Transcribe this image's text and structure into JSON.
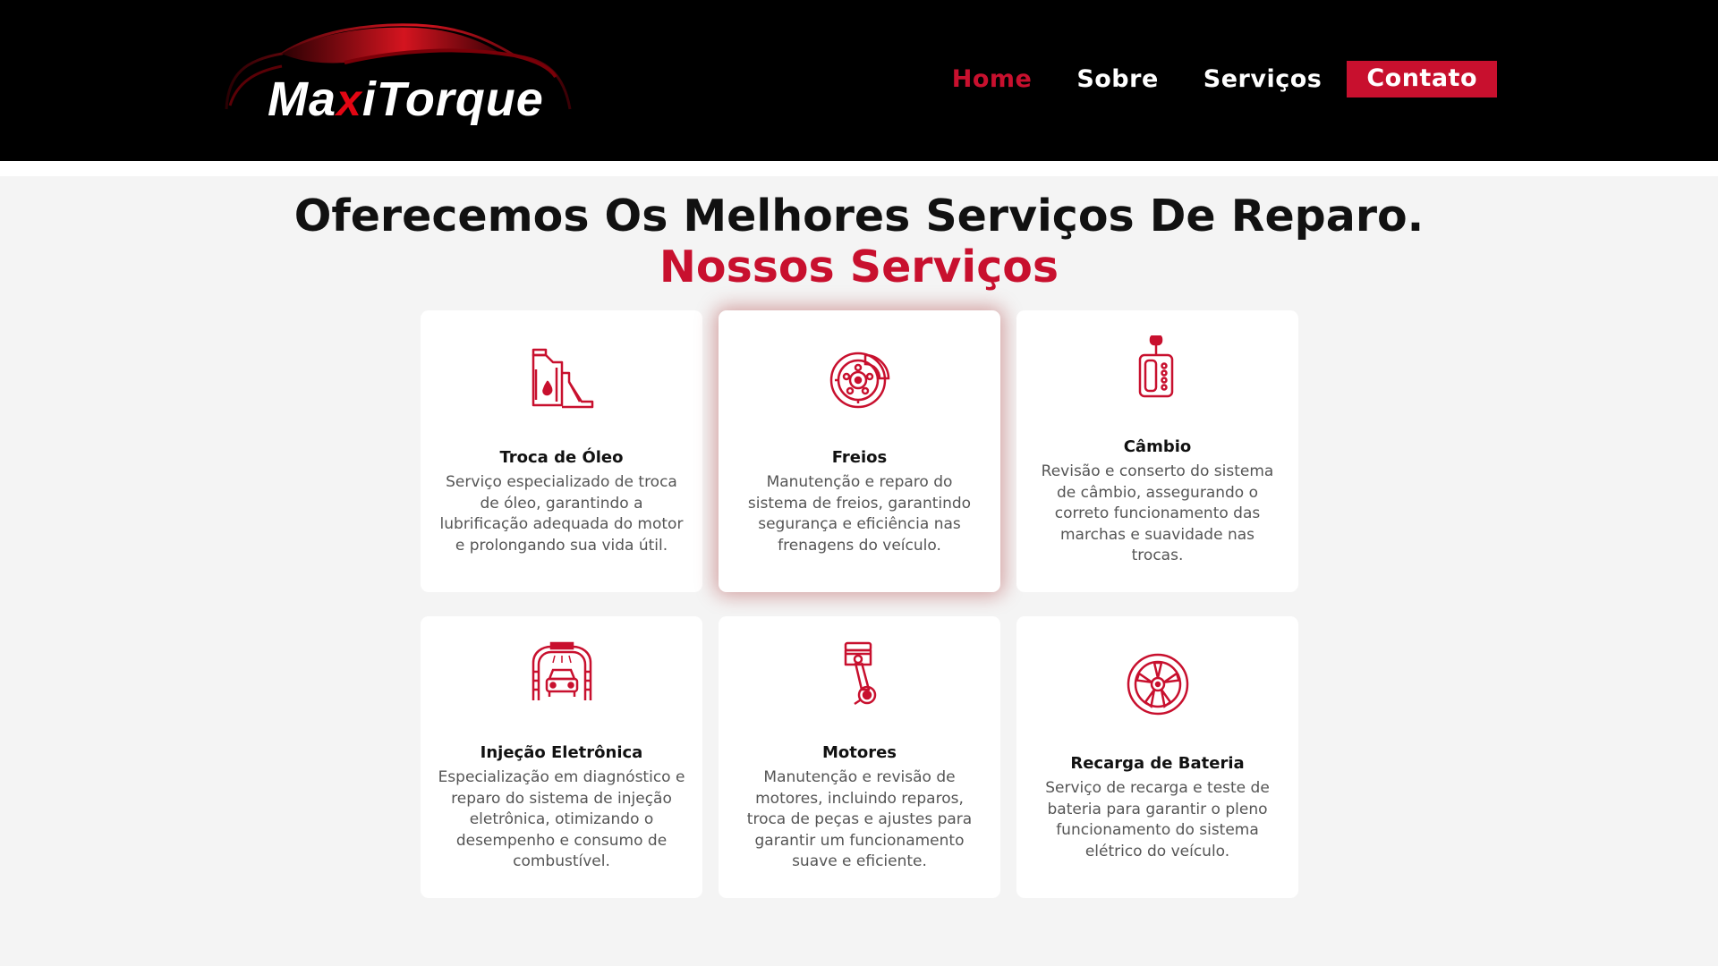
{
  "brand": {
    "name_part1": "Ma",
    "name_x": "x",
    "name_part2": "iTorque",
    "accent_color": "#c8102e"
  },
  "nav": {
    "items": [
      {
        "label": "Home",
        "active": true
      },
      {
        "label": "Sobre",
        "active": false
      },
      {
        "label": "Serviços",
        "active": false
      },
      {
        "label": "Contato",
        "active": false
      }
    ]
  },
  "hero": {
    "headline": "Oferecemos Os Melhores Serviços De Reparo.",
    "subheadline": "Nossos Serviços"
  },
  "services": [
    {
      "icon": "oil-can-icon",
      "title": "Troca de Óleo",
      "description": "Serviço especializado de troca de óleo, garantindo a lubrificação adequada do motor e prolongando sua vida útil."
    },
    {
      "icon": "brake-disc-icon",
      "title": "Freios",
      "description": "Manutenção e reparo do sistema de freios, garantindo segurança e eficiência nas frenagens do veículo."
    },
    {
      "icon": "gear-shifter-icon",
      "title": "Câmbio",
      "description": "Revisão e conserto do sistema de câmbio, assegurando o correto funcionamento das marchas e suavidade nas trocas."
    },
    {
      "icon": "car-wash-icon",
      "title": "Injeção Eletrônica",
      "description": "Especialização em diagnóstico e reparo do sistema de injeção eletrônica, otimizando o desempenho e consumo de combustível."
    },
    {
      "icon": "piston-icon",
      "title": "Motores",
      "description": "Manutenção e revisão de motores, incluindo reparos, troca de peças e ajustes para garantir um funcionamento suave e eficiente."
    },
    {
      "icon": "wheel-icon",
      "title": "Recarga de Bateria",
      "description": "Serviço de recarga e teste de bateria para garantir o pleno funcionamento do sistema elétrico do veículo."
    }
  ]
}
